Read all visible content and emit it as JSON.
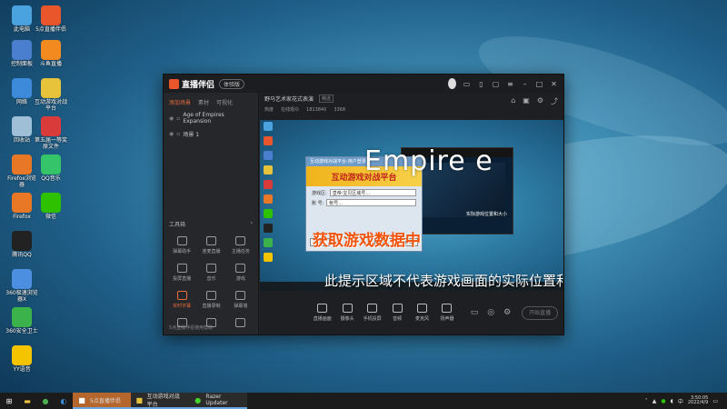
{
  "colors": {
    "accent": "#e96d3c",
    "desktop": "#3f8db4",
    "window_bg": "#232428"
  },
  "desktop_icons": [
    {
      "label": "此电脑",
      "icon": "computer-icon",
      "color": "#4aa3df"
    },
    {
      "label": "5点直播伴侣",
      "icon": "live-app-icon",
      "color": "#e9562c"
    },
    {
      "label": "控制面板",
      "icon": "control-panel-icon",
      "color": "#4a7fd0"
    },
    {
      "label": "斗鱼直播",
      "icon": "douyu-icon",
      "color": "#f28a1f"
    },
    {
      "label": "网络",
      "icon": "network-icon",
      "color": "#3c8ad9"
    },
    {
      "label": "互动游戏对战平台",
      "icon": "game-platform-icon",
      "color": "#e6c33a"
    },
    {
      "label": "回收站",
      "icon": "recycle-bin-icon",
      "color": "#9fbfd6"
    },
    {
      "label": "第五届一等奖原文件",
      "icon": "file-icon",
      "color": "#d93b3b"
    },
    {
      "label": "Firefox浏览器",
      "icon": "firefox-icon",
      "color": "#e87726"
    },
    {
      "label": "Firefox",
      "icon": "firefox-icon",
      "color": "#e87726"
    },
    {
      "label": "QQ音乐",
      "icon": "qq-music-icon",
      "color": "#35c46a"
    },
    {
      "label": "微信",
      "icon": "wechat-icon",
      "color": "#2dc100"
    },
    {
      "label": "腾讯QQ",
      "icon": "qq-icon",
      "color": "#222"
    },
    {
      "label": "360极速浏览器X",
      "icon": "browser-360-icon",
      "color": "#4c8fe0"
    },
    {
      "label": "360安全卫士",
      "icon": "security-360-icon",
      "color": "#3bb34a"
    },
    {
      "label": "YY语音",
      "icon": "yy-icon",
      "color": "#f5c400"
    }
  ],
  "app": {
    "name": "直播伴侣",
    "version": "体验版",
    "title_icons": [
      "avatar-icon",
      "screen-icon",
      "phone-icon",
      "chat-icon",
      "settings-icon",
      "min-icon",
      "max-icon",
      "close-icon"
    ],
    "left_tabs": [
      "添加场景",
      "素材",
      "可视化"
    ],
    "scenes": [
      "Age of Empires Expansion",
      "场景 1"
    ],
    "toolbox": {
      "label": "工具箱",
      "items": [
        "弹幕助手",
        "连麦直播",
        "主播任务",
        "投屏直播",
        "音乐",
        "游戏",
        "实时字幕",
        "直播录制",
        "弹幕墙",
        "",
        "",
        ""
      ]
    },
    "footer": "5点直播伴侣使用帮助",
    "stream_title": "野马艺术家花式表演",
    "stream_tag": "精选",
    "stream_meta": [
      "热度",
      "在线观众",
      "1813840",
      "3368"
    ],
    "controls": [
      "直播画面",
      "摄像头",
      "手机投屏",
      "音频",
      "麦克风",
      "扬声器"
    ],
    "start_live": "开始直播"
  },
  "preview": {
    "empire_text": "Empire e",
    "dialog_title": "互动游戏对战平台-用户登录",
    "dialog_banner": "互动游戏对战平台",
    "dialog_fields": [
      {
        "label": "游戏区:",
        "value": "皇帝·宝贝区域号..."
      },
      {
        "label": "账  号:",
        "value": "帐号..."
      }
    ],
    "dialog_buttons": [
      "注册",
      "登录",
      "退出"
    ],
    "overlay_text": "获取游戏数据中",
    "notice": "此提示区域不代表游戏画面的实际位置和大小",
    "game_text": "实际游戏位置和大小"
  },
  "taskbar": {
    "apps": [
      "5点直播伴侣",
      "互动游戏对战平台",
      "Razer Updater"
    ],
    "time": "3:50:05",
    "date": "2022/4/9"
  }
}
